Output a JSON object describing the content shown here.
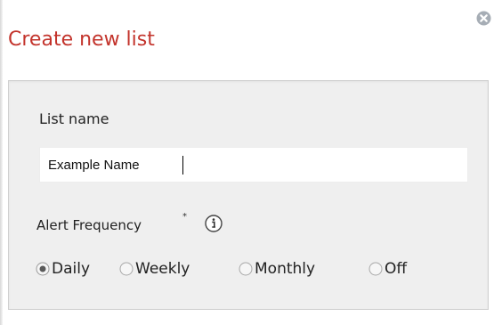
{
  "dialog": {
    "title": "Create new list",
    "close_icon": "close-icon"
  },
  "list_name": {
    "label": "List name",
    "value": "Example Name"
  },
  "alert_frequency": {
    "label": "Alert Frequency",
    "required_marker": "*",
    "info_icon": "info-icon",
    "options": [
      {
        "label": "Daily",
        "selected": true
      },
      {
        "label": "Weekly",
        "selected": false
      },
      {
        "label": "Monthly",
        "selected": false
      },
      {
        "label": "Off",
        "selected": false
      }
    ]
  },
  "colors": {
    "title": "#c3342c",
    "panel_background": "#efefef",
    "panel_border": "#d0d0d0"
  }
}
